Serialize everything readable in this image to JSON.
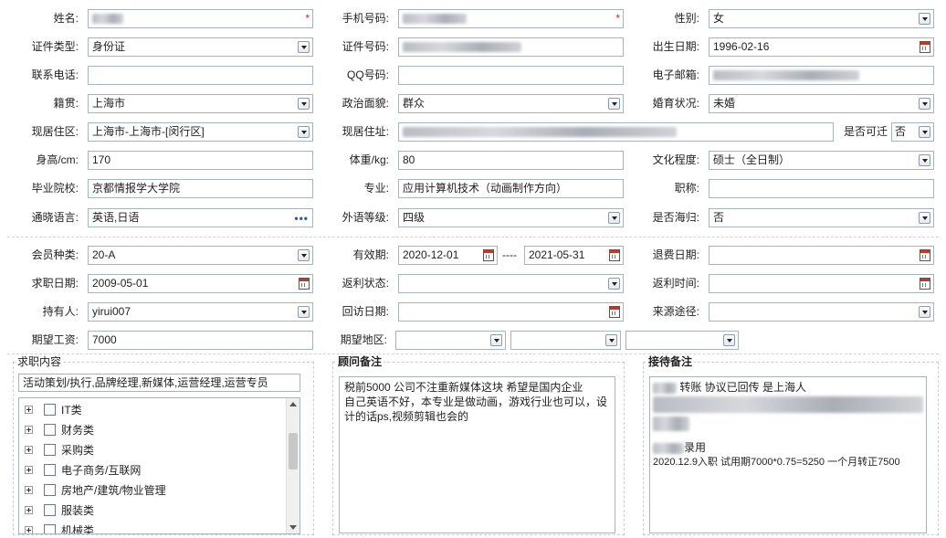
{
  "labels": {
    "name": "姓名:",
    "mobile": "手机号码:",
    "gender": "性别:",
    "id_type": "证件类型:",
    "id_no": "证件号码:",
    "birth": "出生日期:",
    "phone": "联系电话:",
    "qq": "QQ号码:",
    "email": "电子邮箱:",
    "native": "籍贯:",
    "political": "政治面貌:",
    "marital": "婚育状况:",
    "residence_area": "现居住区:",
    "address": "现居住址:",
    "relocate": "是否可迁",
    "height": "身高/cm:",
    "weight": "体重/kg:",
    "education": "文化程度:",
    "school": "毕业院校:",
    "major": "专业:",
    "title": "职称:",
    "languages": "通晓语言:",
    "lang_level": "外语等级:",
    "overseas": "是否海归:",
    "member_type": "会员种类:",
    "valid": "有效期:",
    "refund_date": "退费日期:",
    "job_date": "求职日期:",
    "rebate_status": "返利状态:",
    "rebate_time": "返利时间:",
    "holder": "持有人:",
    "visit_date": "回访日期:",
    "source": "来源途径:",
    "salary": "期望工资:",
    "region": "期望地区:"
  },
  "values": {
    "gender": "女",
    "id_type": "身份证",
    "birth": "1996-02-16",
    "native": "上海市",
    "political": "群众",
    "marital": "未婚",
    "residence_area": "上海市-上海市-[闵行区]",
    "relocate": "否",
    "height": "170",
    "weight": "80",
    "education": "硕士（全日制）",
    "school": "京都情报学大学院",
    "major": "应用计算机技术（动画制作方向）",
    "languages": "英语,日语",
    "lang_level": "四级",
    "overseas": "否",
    "member_type": "20-A",
    "valid_from": "2020-12-01",
    "valid_sep": "----",
    "valid_to": "2021-05-31",
    "job_date": "2009-05-01",
    "holder": "yirui007",
    "salary": "7000"
  },
  "job_content": {
    "title": "求职内容",
    "selected": "活动策划/执行,品牌经理,新媒体,运营经理,运营专员",
    "categories": [
      "IT类",
      "财务类",
      "采购类",
      "电子商务/互联网",
      "房地产/建筑/物业管理",
      "服装类",
      "机械类"
    ]
  },
  "advisor_note": {
    "title": "顾问备注",
    "lines": [
      "税前5000    公司不注重新媒体这块   希望是国内企业",
      "自己英语不好，本专业是做动画，游戏行业也可以，设",
      "计的话ps,视频剪辑也会的"
    ]
  },
  "reception_note": {
    "title": "接待备注",
    "line1": "转账 协议已回传   是上海人",
    "line2": "录用",
    "line3": "2020.12.9入职 试用期7000*0.75=5250 一个月转正7500"
  },
  "icons": {
    "dropdown": "chevron-down-icon",
    "calendar": "calendar-icon",
    "more": "more-dots-icon",
    "expand": "plus-expand-icon"
  },
  "colors": {
    "border": "#a9b3bf",
    "required": "#e02020"
  }
}
